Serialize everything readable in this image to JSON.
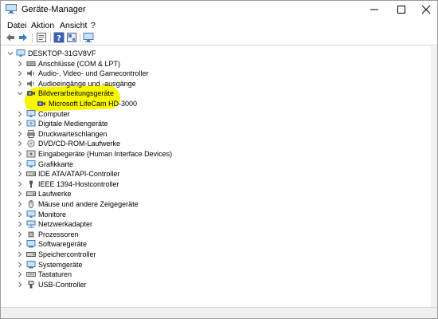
{
  "window": {
    "title": "Geräte-Manager"
  },
  "menu": [
    "Datei",
    "Aktion",
    "Ansicht",
    "?"
  ],
  "toolbar": {
    "buttons": [
      "back-arrow-icon",
      "forward-arrow-icon",
      "properties-icon",
      "help-icon",
      "view-icon",
      "monitor-icon"
    ]
  },
  "tree": {
    "root": "DESKTOP-31GV8VF",
    "items": [
      {
        "label": "Anschlüsse (COM & LPT)",
        "icon": "port-icon",
        "expanded": false
      },
      {
        "label": "Audio-, Video- und Gamecontroller",
        "icon": "speaker-icon",
        "expanded": false
      },
      {
        "label": "Audioeingänge und -ausgänge",
        "icon": "speaker-icon",
        "expanded": false
      },
      {
        "label": "Bildverarbeitungsgeräte",
        "icon": "camera-icon",
        "expanded": true,
        "children": [
          {
            "label": "Microsoft LifeCam HD-3000",
            "icon": "camera-icon"
          }
        ]
      },
      {
        "label": "Computer",
        "icon": "computer-icon",
        "expanded": false
      },
      {
        "label": "Digitale Mediengeräte",
        "icon": "media-icon",
        "expanded": false
      },
      {
        "label": "Druckwarteschlangen",
        "icon": "printer-icon",
        "expanded": false
      },
      {
        "label": "DVD/CD-ROM-Laufwerke",
        "icon": "disc-icon",
        "expanded": false
      },
      {
        "label": "Eingabegeräte (Human Interface Devices)",
        "icon": "hid-icon",
        "expanded": false
      },
      {
        "label": "Grafikkarte",
        "icon": "display-adapter-icon",
        "expanded": false
      },
      {
        "label": "IDE ATA/ATAPI-Controller",
        "icon": "ide-icon",
        "expanded": false
      },
      {
        "label": "IEEE 1394-Hostcontroller",
        "icon": "firewire-icon",
        "expanded": false
      },
      {
        "label": "Laufwerke",
        "icon": "drive-icon",
        "expanded": false
      },
      {
        "label": "Mäuse und andere Zeigegeräte",
        "icon": "mouse-icon",
        "expanded": false
      },
      {
        "label": "Monitore",
        "icon": "monitor-icon",
        "expanded": false
      },
      {
        "label": "Netzwerkadapter",
        "icon": "network-icon",
        "expanded": false
      },
      {
        "label": "Prozessoren",
        "icon": "processor-icon",
        "expanded": false
      },
      {
        "label": "Softwaregeräte",
        "icon": "software-icon",
        "expanded": false
      },
      {
        "label": "Speichercontroller",
        "icon": "storage-icon",
        "expanded": false
      },
      {
        "label": "Systemgeräte",
        "icon": "system-icon",
        "expanded": false
      },
      {
        "label": "Tastaturen",
        "icon": "keyboard-icon",
        "expanded": false
      },
      {
        "label": "USB-Controller",
        "icon": "usb-icon",
        "expanded": false
      }
    ]
  },
  "colors": {
    "highlight": "#f8f700",
    "icon_blue": "#3c7fc4",
    "chevron": "#666666"
  }
}
